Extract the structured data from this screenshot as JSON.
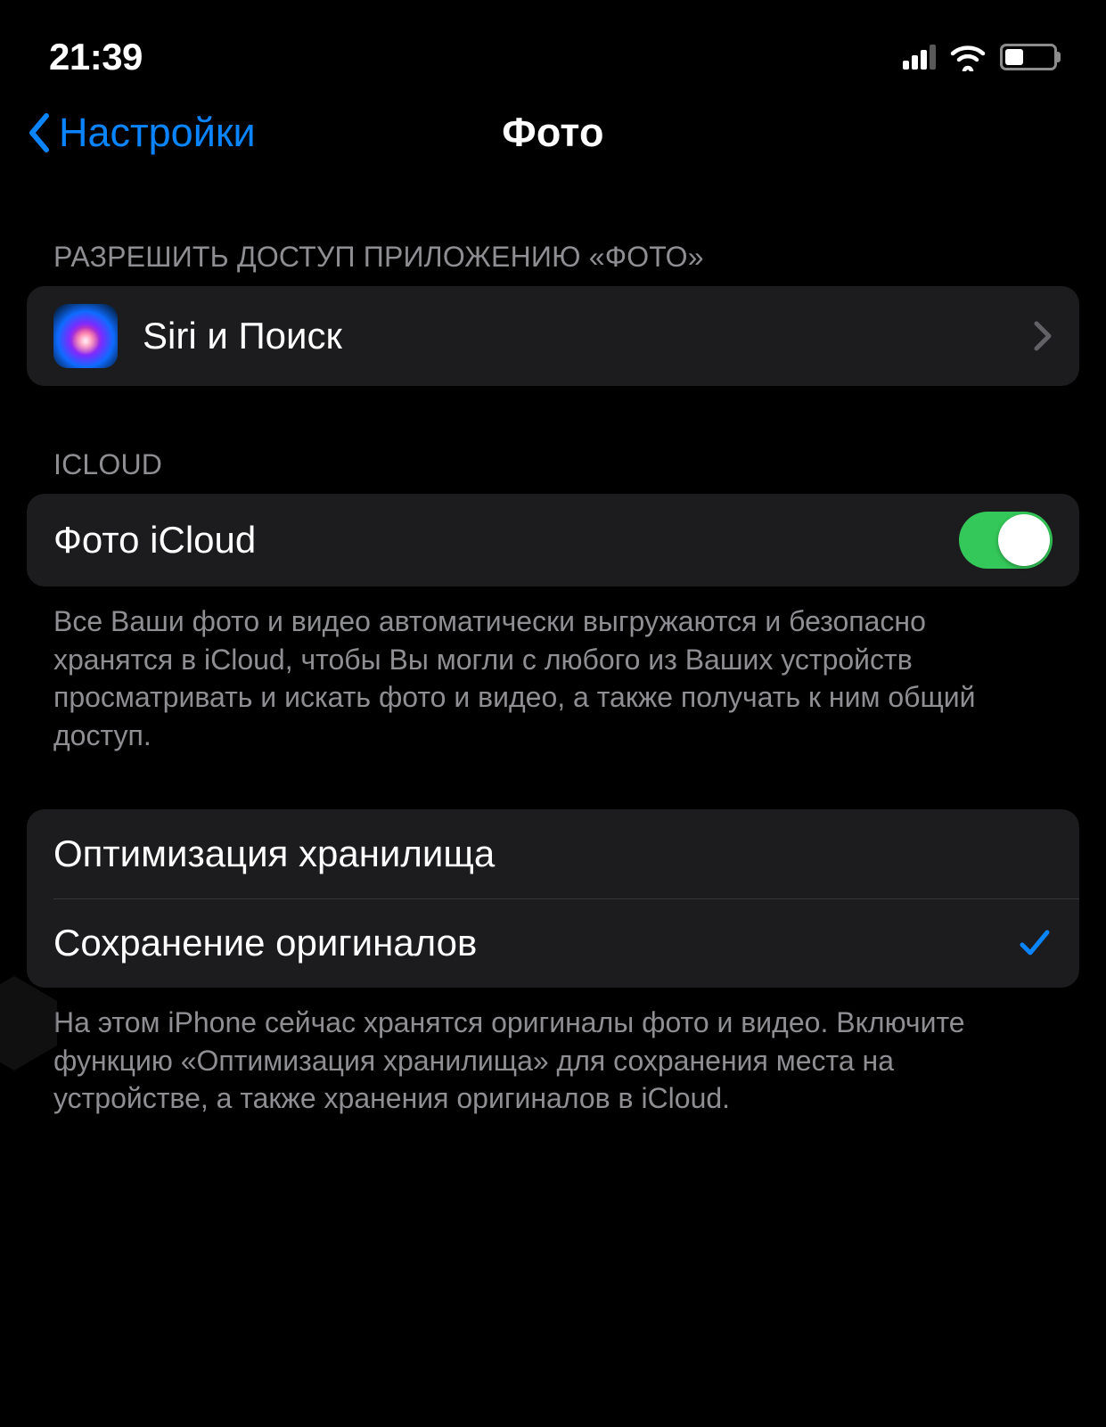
{
  "statusbar": {
    "time": "21:39"
  },
  "nav": {
    "back_label": "Настройки",
    "title": "Фото"
  },
  "sections": {
    "access": {
      "header": "РАЗРЕШИТЬ ДОСТУП ПРИЛОЖЕНИЮ «ФОТО»",
      "siri_label": "Siri и Поиск"
    },
    "icloud": {
      "header": "ICLOUD",
      "photos_label": "Фото iCloud",
      "photos_on": true,
      "footer": "Все Ваши фото и видео автоматически выгружаются и безопасно хранятся в iCloud, чтобы Вы могли с любого из Ваших устройств просматривать и искать фото и видео, а также получать к ним общий доступ."
    },
    "storage": {
      "optimize_label": "Оптимизация хранилища",
      "download_label": "Сохранение оригиналов",
      "selected": "download",
      "footer": "На этом iPhone сейчас хранятся оригиналы фото и видео. Включите функцию «Оптимизация хранилища» для сохранения места на устройстве, а также хранения оригиналов в iCloud."
    }
  }
}
